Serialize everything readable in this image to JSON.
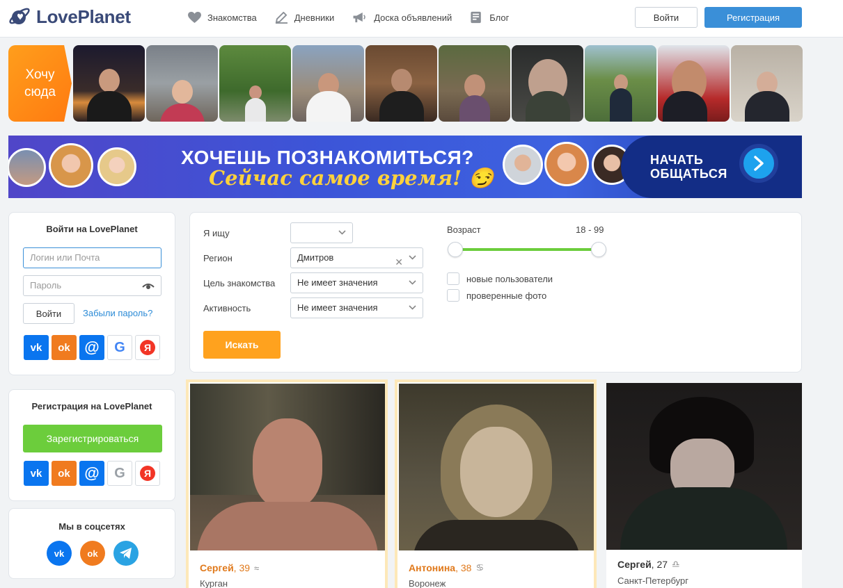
{
  "header": {
    "brand": "LovePlanet",
    "nav": [
      {
        "label": "Знакомства",
        "icon": "heart-icon"
      },
      {
        "label": "Дневники",
        "icon": "pencil-icon"
      },
      {
        "label": "Доска объявлений",
        "icon": "megaphone-icon"
      },
      {
        "label": "Блог",
        "icon": "blog-icon"
      }
    ],
    "login_label": "Войти",
    "register_label": "Регистрация"
  },
  "strip": {
    "want_here": "Хочу сюда"
  },
  "banner": {
    "title": "ХОЧЕШЬ ПОЗНАКОМИТЬСЯ?",
    "subtitle": "Сейчас самое время! 😏",
    "cta_line1": "НАЧАТЬ",
    "cta_line2": "ОБЩАТЬСЯ"
  },
  "login_card": {
    "title": "Войти на LovePlanet",
    "login_placeholder": "Логин или Почта",
    "password_placeholder": "Пароль",
    "submit_label": "Войти",
    "forgot_label": "Забыли пароль?"
  },
  "register_card": {
    "title": "Регистрация на LovePlanet",
    "register_label": "Зарегистрироваться"
  },
  "social_card": {
    "title": "Мы в соцсетях"
  },
  "filter": {
    "seeking_label": "Я ищу",
    "seeking_value": "",
    "region_label": "Регион",
    "region_value": "Дмитров",
    "goal_label": "Цель знакомства",
    "goal_value": "Не имеет значения",
    "activity_label": "Активность",
    "activity_value": "Не имеет значения",
    "search_label": "Искать",
    "age_label": "Возраст",
    "age_range": "18 - 99",
    "age_min": 18,
    "age_max": 99,
    "new_users_label": "новые пользователи",
    "verified_label": "проверенные фото"
  },
  "profiles": [
    {
      "name": "Сергей",
      "age": ", 39",
      "zodiac": "≈",
      "city": "Курган",
      "highlight": true
    },
    {
      "name": "Антонина",
      "age": ", 38",
      "zodiac": "♋",
      "city": "Воронеж",
      "highlight": true
    },
    {
      "name": "Сергей",
      "age": ", 27",
      "zodiac": "♎",
      "city": "Санкт-Петербург",
      "highlight": false
    }
  ],
  "colors": {
    "accent_blue": "#3a8fd8",
    "orange": "#ffa21e",
    "green": "#6ccd3c"
  }
}
